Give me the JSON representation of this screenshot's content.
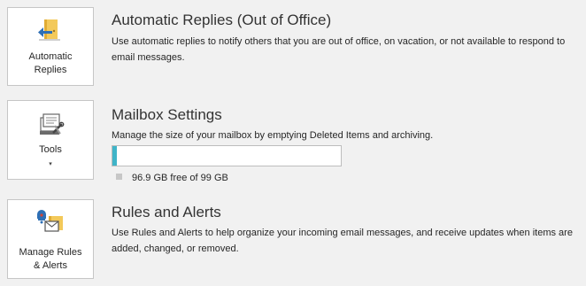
{
  "automatic_replies": {
    "button_label": "Automatic\nReplies",
    "title": "Automatic Replies (Out of Office)",
    "description": "Use automatic replies to notify others that you are out of office, on vacation, or not available to respond to email messages."
  },
  "mailbox_settings": {
    "button_label": "Tools",
    "dropdown_arrow": "▾",
    "title": "Mailbox Settings",
    "description": "Manage the size of your mailbox by emptying Deleted Items and archiving.",
    "usage_fraction": 0.021,
    "quota_text": "96.9 GB free of 99 GB",
    "usage_color": "#3fb4c8"
  },
  "rules_alerts": {
    "button_label": "Manage Rules\n& Alerts",
    "title": "Rules and Alerts",
    "description": "Use Rules and Alerts to help organize your incoming email messages, and receive updates when items are added, changed, or removed."
  },
  "icons": {
    "automatic_replies": "door-arrow-icon",
    "tools": "tools-icon",
    "manage_rules": "rules-alerts-icon"
  }
}
